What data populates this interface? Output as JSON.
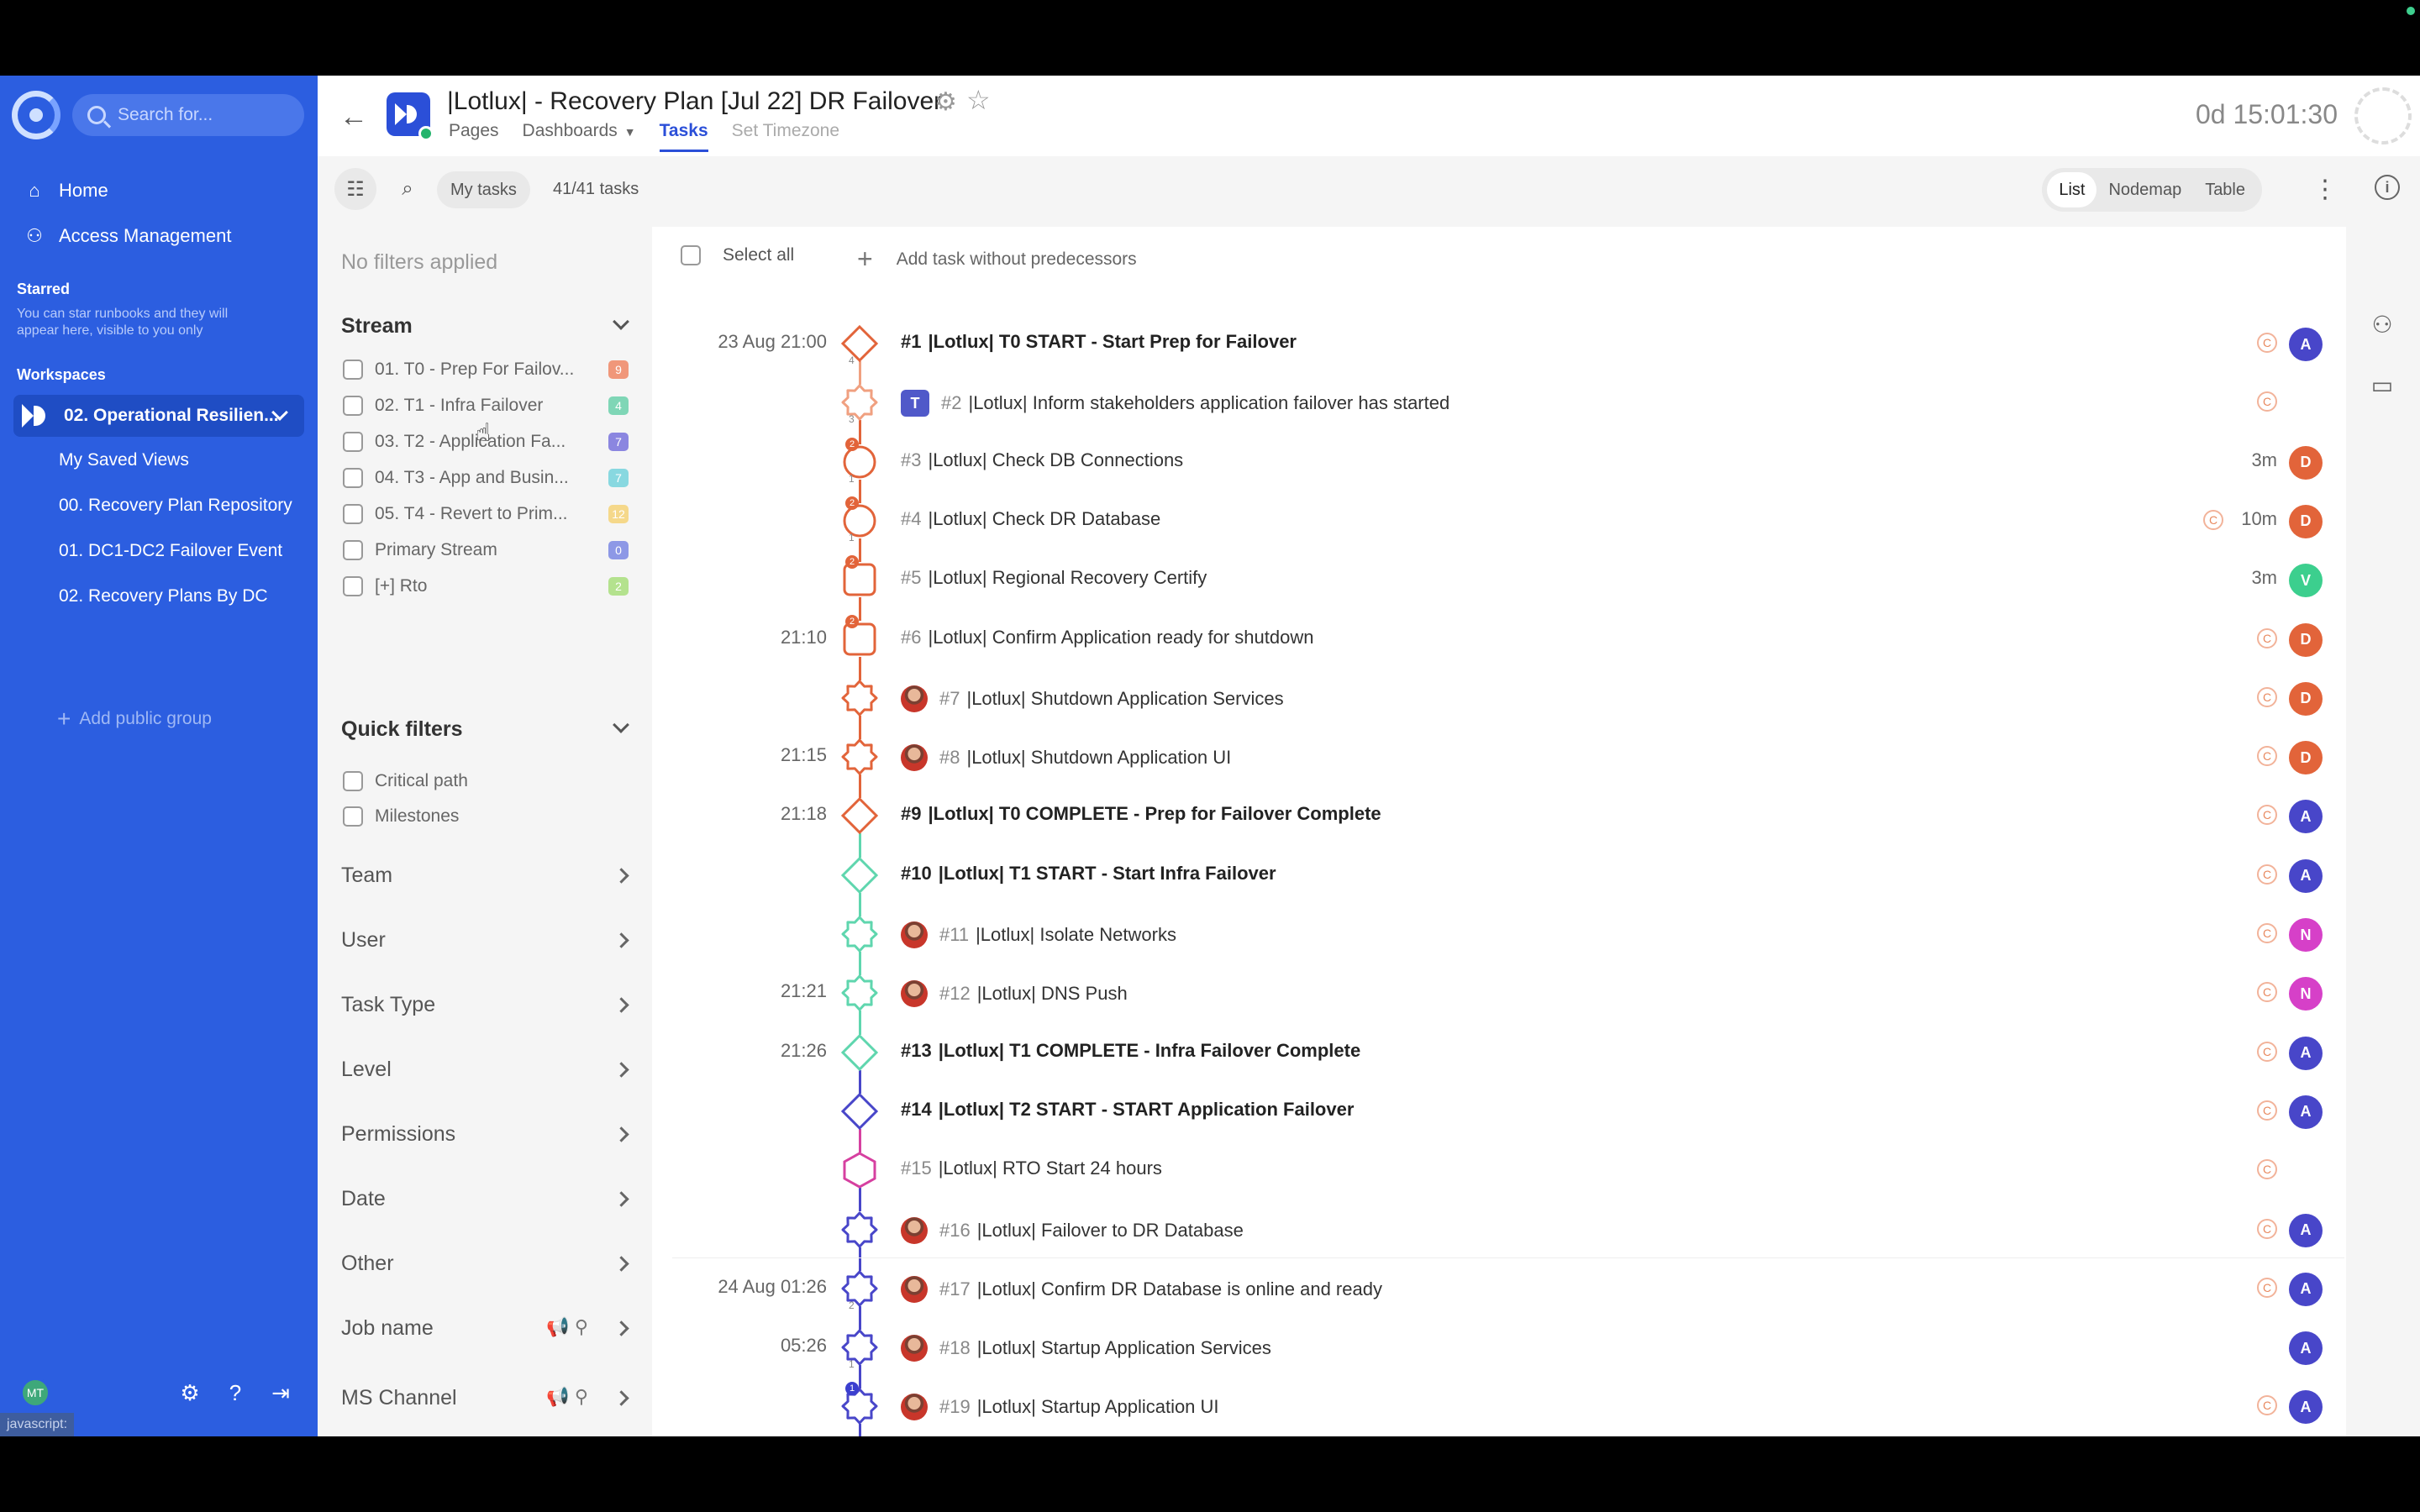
{
  "nav": {
    "search_placeholder": "Search for...",
    "items": [
      {
        "label": "Home",
        "icon": "home-icon"
      },
      {
        "label": "Access Management",
        "icon": "users-icon"
      }
    ],
    "starred_title": "Starred",
    "starred_hint": "You can star runbooks and they will appear here, visible to you only",
    "workspaces_title": "Workspaces",
    "active_workspace": "02. Operational Resilien...",
    "workspace_items": [
      "My Saved Views",
      "00. Recovery Plan Repository",
      "01. DC1-DC2 Failover Event",
      "02. Recovery Plans By DC"
    ],
    "add_group": "Add public group",
    "user_initials": "MT",
    "status_url": "javascript:"
  },
  "header": {
    "title": "|Lotlux| - Recovery Plan [Jul 22] DR Failover",
    "tabs": [
      "Pages",
      "Dashboards",
      "Tasks",
      "Set Timezone"
    ],
    "active_tab": "Tasks",
    "timer": "0d 15:01:30"
  },
  "toolbar": {
    "my_tasks": "My tasks",
    "count": "41/41 tasks",
    "views": [
      "List",
      "Nodemap",
      "Table"
    ],
    "active_view": "List"
  },
  "filters": {
    "no_filters": "No filters applied",
    "stream_title": "Stream",
    "streams": [
      {
        "label": "01. T0 - Prep For Failov...",
        "count": "9",
        "color": "#f0977a"
      },
      {
        "label": "02. T1 - Infra Failover",
        "count": "4",
        "color": "#7fd6b6"
      },
      {
        "label": "03. T2 - Application Fa...",
        "count": "7",
        "color": "#8b86e0"
      },
      {
        "label": "04. T3 - App and Busin...",
        "count": "7",
        "color": "#88d8e0"
      },
      {
        "label": "05. T4 - Revert to Prim...",
        "count": "12",
        "color": "#f5d88a"
      },
      {
        "label": "Primary Stream",
        "count": "0",
        "color": "#8d98e6"
      },
      {
        "label": "[+] Rto",
        "count": "2",
        "color": "#b4e28e"
      }
    ],
    "quick_title": "Quick filters",
    "quick": [
      "Critical path",
      "Milestones"
    ],
    "groups": [
      "Team",
      "User",
      "Task Type",
      "Level",
      "Permissions",
      "Date",
      "Other",
      "Job name",
      "MS Channel"
    ]
  },
  "main": {
    "select_all": "Select all",
    "add_task": "Add task without predecessors",
    "tasks": [
      {
        "time": "23 Aug 21:00",
        "num": "#1",
        "title": "|Lotlux| T0 START - Start Prep for Failover",
        "bold": true,
        "shape": "diamond",
        "color": "#e2643a",
        "sub": "4",
        "flag": "",
        "icon": "",
        "dur": "",
        "c": true,
        "av": "A",
        "avc": "#4846c9"
      },
      {
        "time": "",
        "num": "#2",
        "title": "|Lotlux| Inform stakeholders application failover has started",
        "bold": false,
        "shape": "gear",
        "color": "#f0a080",
        "sub": "3",
        "flag": "",
        "icon": "teams",
        "dur": "",
        "c": true,
        "av": "",
        "avc": "#ccc"
      },
      {
        "time": "",
        "num": "#3",
        "title": "|Lotlux| Check DB Connections",
        "bold": false,
        "shape": "circle",
        "color": "#e2643a",
        "sub": "1",
        "flag": "2",
        "icon": "",
        "dur": "3m",
        "c": false,
        "av": "D",
        "avc": "#e2643a"
      },
      {
        "time": "",
        "num": "#4",
        "title": "|Lotlux| Check DR Database",
        "bold": false,
        "shape": "circle",
        "color": "#e2643a",
        "sub": "1",
        "flag": "2",
        "icon": "",
        "dur": "10m",
        "c": true,
        "av": "D",
        "avc": "#e2643a"
      },
      {
        "time": "",
        "num": "#5",
        "title": "|Lotlux| Regional Recovery Certify",
        "bold": false,
        "shape": "square",
        "color": "#e2643a",
        "sub": "",
        "flag": "2",
        "icon": "",
        "dur": "3m",
        "c": false,
        "av": "V",
        "avc": "#3ccf8e"
      },
      {
        "time": "21:10",
        "num": "#6",
        "title": "|Lotlux| Confirm Application ready for shutdown",
        "bold": false,
        "shape": "square",
        "color": "#e2643a",
        "sub": "",
        "flag": "2",
        "icon": "",
        "dur": "",
        "c": true,
        "av": "D",
        "avc": "#e2643a"
      },
      {
        "time": "",
        "num": "#7",
        "title": "|Lotlux| Shutdown Application Services",
        "bold": false,
        "shape": "gear",
        "color": "#e2643a",
        "sub": "",
        "flag": "",
        "icon": "person",
        "dur": "",
        "c": true,
        "av": "D",
        "avc": "#e2643a"
      },
      {
        "time": "21:15",
        "num": "#8",
        "title": "|Lotlux| Shutdown Application UI",
        "bold": false,
        "shape": "gear",
        "color": "#e2643a",
        "sub": "",
        "flag": "",
        "icon": "person",
        "dur": "",
        "c": true,
        "av": "D",
        "avc": "#e2643a"
      },
      {
        "time": "21:18",
        "num": "#9",
        "title": "|Lotlux| T0 COMPLETE - Prep for Failover Complete",
        "bold": true,
        "shape": "diamond",
        "color": "#e2643a",
        "sub": "",
        "flag": "",
        "icon": "",
        "dur": "",
        "c": true,
        "av": "A",
        "avc": "#4846c9"
      },
      {
        "time": "",
        "num": "#10",
        "title": "|Lotlux| T1 START - Start Infra Failover",
        "bold": true,
        "shape": "diamond",
        "color": "#5fd6ae",
        "sub": "",
        "flag": "",
        "icon": "",
        "dur": "",
        "c": true,
        "av": "A",
        "avc": "#4846c9"
      },
      {
        "time": "",
        "num": "#11",
        "title": "|Lotlux| Isolate Networks",
        "bold": false,
        "shape": "gear",
        "color": "#5fd6ae",
        "sub": "",
        "flag": "",
        "icon": "person",
        "dur": "",
        "c": true,
        "av": "N",
        "avc": "#d640c8"
      },
      {
        "time": "21:21",
        "num": "#12",
        "title": "|Lotlux| DNS Push",
        "bold": false,
        "shape": "gear",
        "color": "#5fd6ae",
        "sub": "",
        "flag": "",
        "icon": "person",
        "dur": "",
        "c": true,
        "av": "N",
        "avc": "#d640c8"
      },
      {
        "time": "21:26",
        "num": "#13",
        "title": "|Lotlux| T1 COMPLETE - Infra Failover Complete",
        "bold": true,
        "shape": "diamond",
        "color": "#5fd6ae",
        "sub": "",
        "flag": "",
        "icon": "",
        "dur": "",
        "c": true,
        "av": "A",
        "avc": "#4846c9"
      },
      {
        "time": "",
        "num": "#14",
        "title": "|Lotlux| T2 START - START Application Failover",
        "bold": true,
        "shape": "diamond",
        "color": "#4846c9",
        "sub": "",
        "flag": "",
        "icon": "",
        "dur": "",
        "c": true,
        "av": "A",
        "avc": "#4846c9"
      },
      {
        "time": "",
        "num": "#15",
        "title": "|Lotlux| RTO Start 24 hours",
        "bold": false,
        "shape": "hexagon",
        "color": "#d640a0",
        "sub": "",
        "flag": "",
        "icon": "",
        "dur": "",
        "c": true,
        "av": "",
        "avc": "#ccc"
      },
      {
        "time": "",
        "num": "#16",
        "title": "|Lotlux| Failover to DR Database",
        "bold": false,
        "shape": "gear",
        "color": "#4846c9",
        "sub": "",
        "flag": "",
        "icon": "person",
        "dur": "",
        "c": true,
        "av": "A",
        "avc": "#4846c9"
      },
      {
        "time": "24 Aug 01:26",
        "num": "#17",
        "title": "|Lotlux| Confirm DR Database is online and ready",
        "bold": false,
        "shape": "gear",
        "color": "#4846c9",
        "sub": "2",
        "flag": "",
        "icon": "person",
        "dur": "",
        "c": true,
        "av": "A",
        "avc": "#4846c9"
      },
      {
        "time": "05:26",
        "num": "#18",
        "title": "|Lotlux| Startup Application Services",
        "bold": false,
        "shape": "gear",
        "color": "#4846c9",
        "sub": "1",
        "flag": "",
        "icon": "person",
        "dur": "",
        "c": false,
        "av": "A",
        "avc": "#4846c9"
      },
      {
        "time": "",
        "num": "#19",
        "title": "|Lotlux| Startup Application UI",
        "bold": false,
        "shape": "gear",
        "color": "#4846c9",
        "sub": "",
        "flag": "1",
        "icon": "person",
        "dur": "",
        "c": true,
        "av": "A",
        "avc": "#4846c9"
      }
    ]
  }
}
